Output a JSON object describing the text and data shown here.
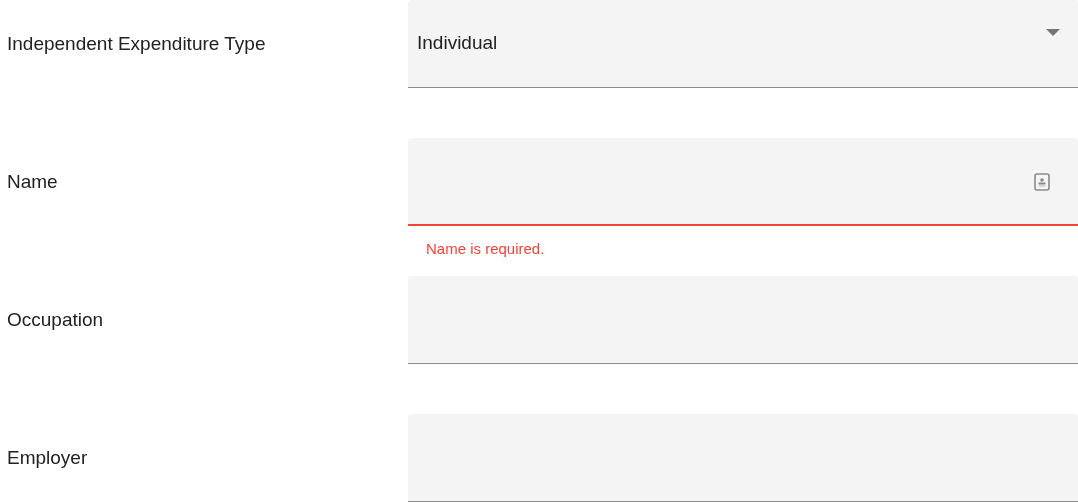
{
  "fields": [
    {
      "label": "Independent Expenditure Type",
      "kind": "select",
      "value": "Individual",
      "invalid": false
    },
    {
      "label": "Name",
      "kind": "lookup",
      "invalid": true,
      "error": "Name is required."
    },
    {
      "label": "Occupation",
      "kind": "text",
      "invalid": false
    },
    {
      "label": "Employer",
      "kind": "text",
      "invalid": false
    }
  ]
}
